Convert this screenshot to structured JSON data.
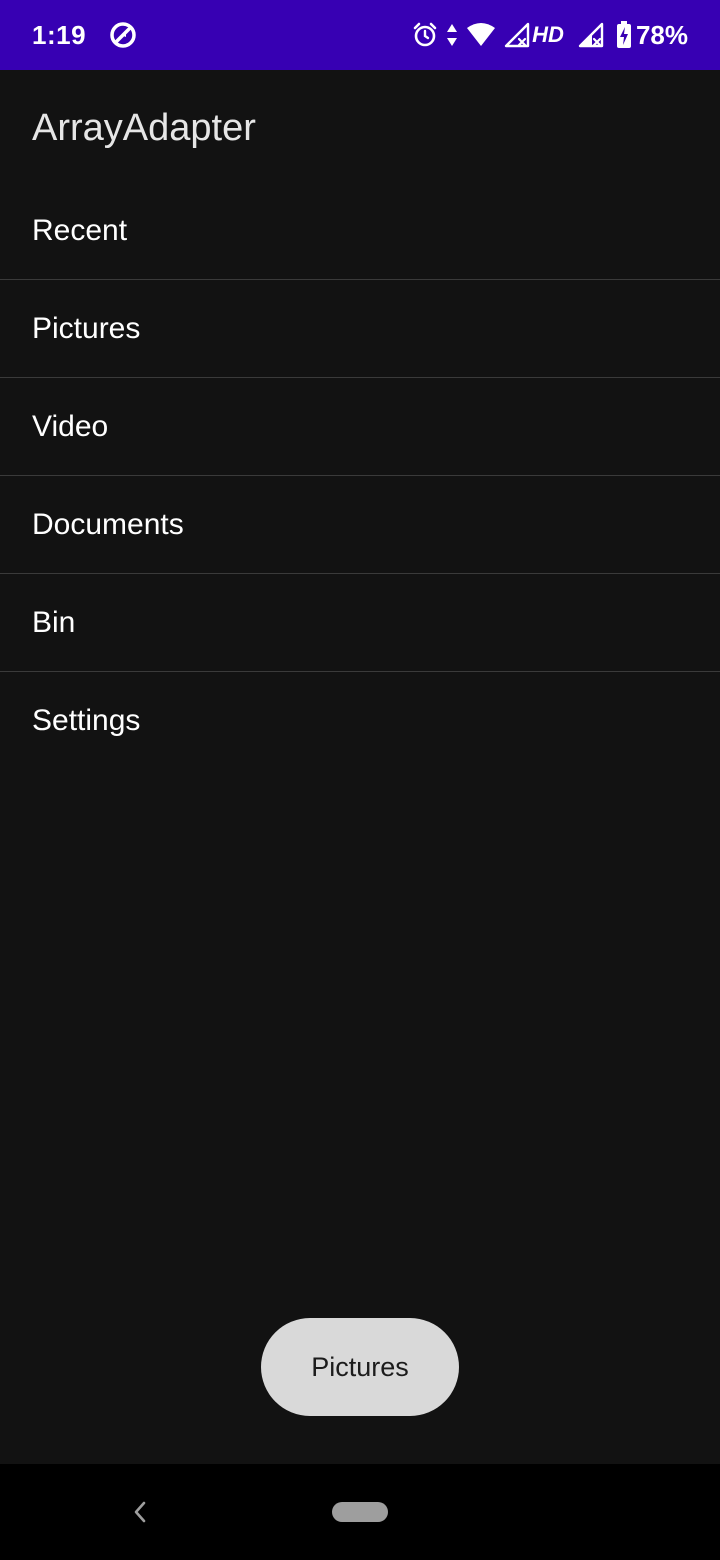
{
  "status_bar": {
    "time": "1:19",
    "hd_label": "HD",
    "battery_percent": "78%",
    "background_color": "#3700b3",
    "icons": [
      "data-saver-icon",
      "alarm-icon",
      "data-arrows-icon",
      "wifi-icon",
      "signal-icon",
      "signal-icon",
      "battery-charging-icon"
    ]
  },
  "app": {
    "title": "ArrayAdapter"
  },
  "list": {
    "items": [
      {
        "label": "Recent"
      },
      {
        "label": "Pictures"
      },
      {
        "label": "Video"
      },
      {
        "label": "Documents"
      },
      {
        "label": "Bin"
      },
      {
        "label": "Settings"
      }
    ]
  },
  "toast": {
    "message": "Pictures"
  },
  "nav_bar": {
    "icons": [
      "back-icon",
      "home-pill-icon"
    ]
  }
}
